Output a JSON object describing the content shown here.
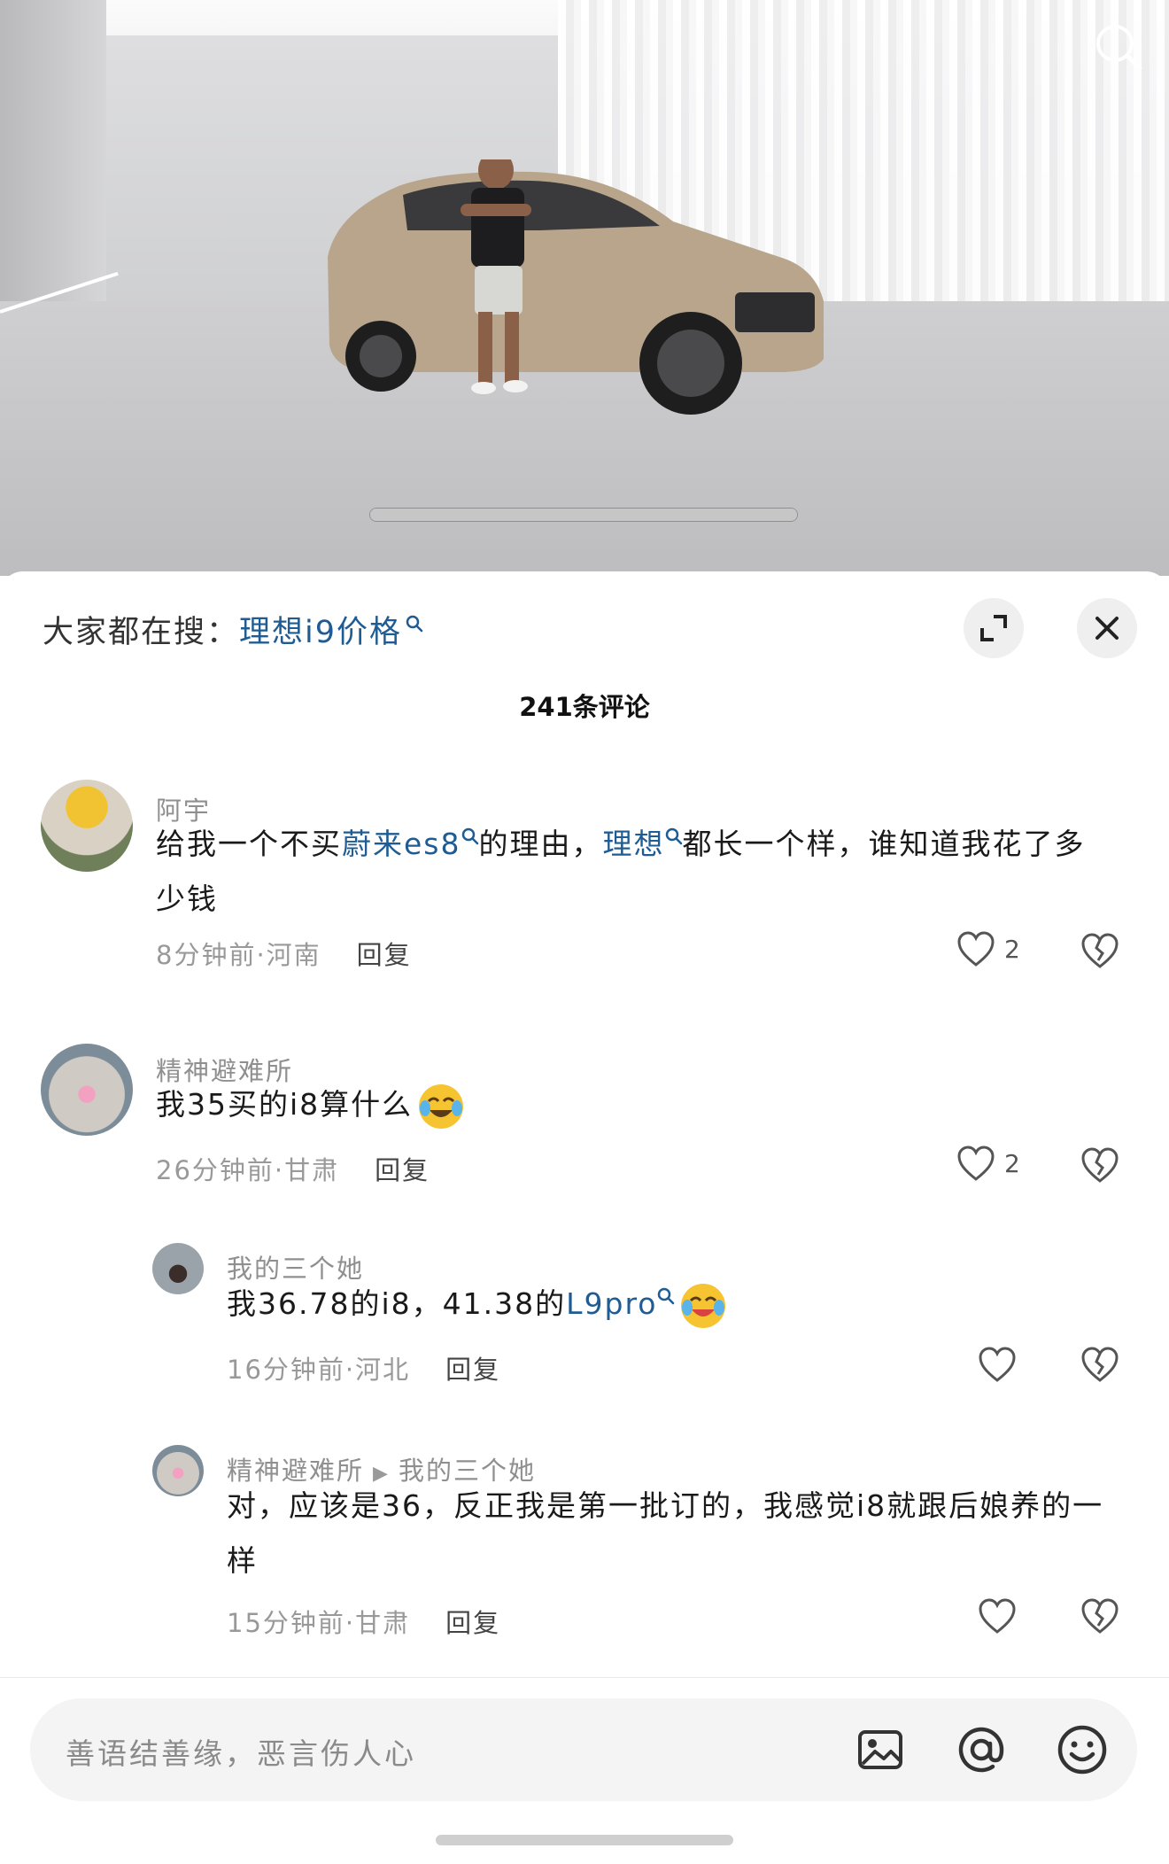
{
  "search_bar": {
    "prefix": "大家都在搜：",
    "query": "理想i9价格"
  },
  "comments_header": {
    "count_label": "241条评论"
  },
  "comments": [
    {
      "user": "阿宇",
      "text_parts": [
        "给我一个不买",
        "蔚来es8",
        "的理由，",
        "理想",
        "都长一个样，谁知道我花了多少钱"
      ],
      "time_location": "8分钟前·河南",
      "reply": "回复",
      "likes": "2"
    },
    {
      "user": "精神避难所",
      "text": "我35买的i8算什么",
      "time_location": "26分钟前·甘肃",
      "reply": "回复",
      "likes": "2"
    }
  ],
  "replies": [
    {
      "user": "我的三个她",
      "text_parts": [
        "我36.78的i8，41.38的",
        "L9pro"
      ],
      "time_location": "16分钟前·河北",
      "reply": "回复"
    },
    {
      "user": "精神避难所",
      "reply_to": "我的三个她",
      "text": "对，应该是36，反正我是第一批订的，我感觉i8就跟后娘养的一样",
      "time_location": "15分钟前·甘肃",
      "reply": "回复"
    }
  ],
  "composer": {
    "placeholder": "善语结善缘，恶言伤人心",
    "icons": [
      "image-icon",
      "at-icon",
      "emoji-icon"
    ]
  },
  "colors": {
    "link": "#1f5c93",
    "meta": "#999999"
  }
}
